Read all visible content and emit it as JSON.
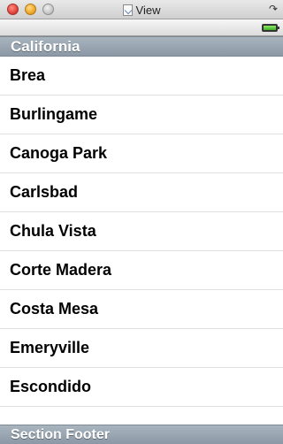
{
  "window": {
    "title": "View",
    "rotate_icon": "rotate-icon"
  },
  "status": {
    "battery_level": 1.0,
    "battery_color": "#3fae25"
  },
  "section": {
    "header": "California",
    "footer": "Section Footer",
    "rows": [
      "Brea",
      "Burlingame",
      "Canoga Park",
      "Carlsbad",
      "Chula Vista",
      "Corte Madera",
      "Costa Mesa",
      "Emeryville",
      "Escondido"
    ]
  }
}
